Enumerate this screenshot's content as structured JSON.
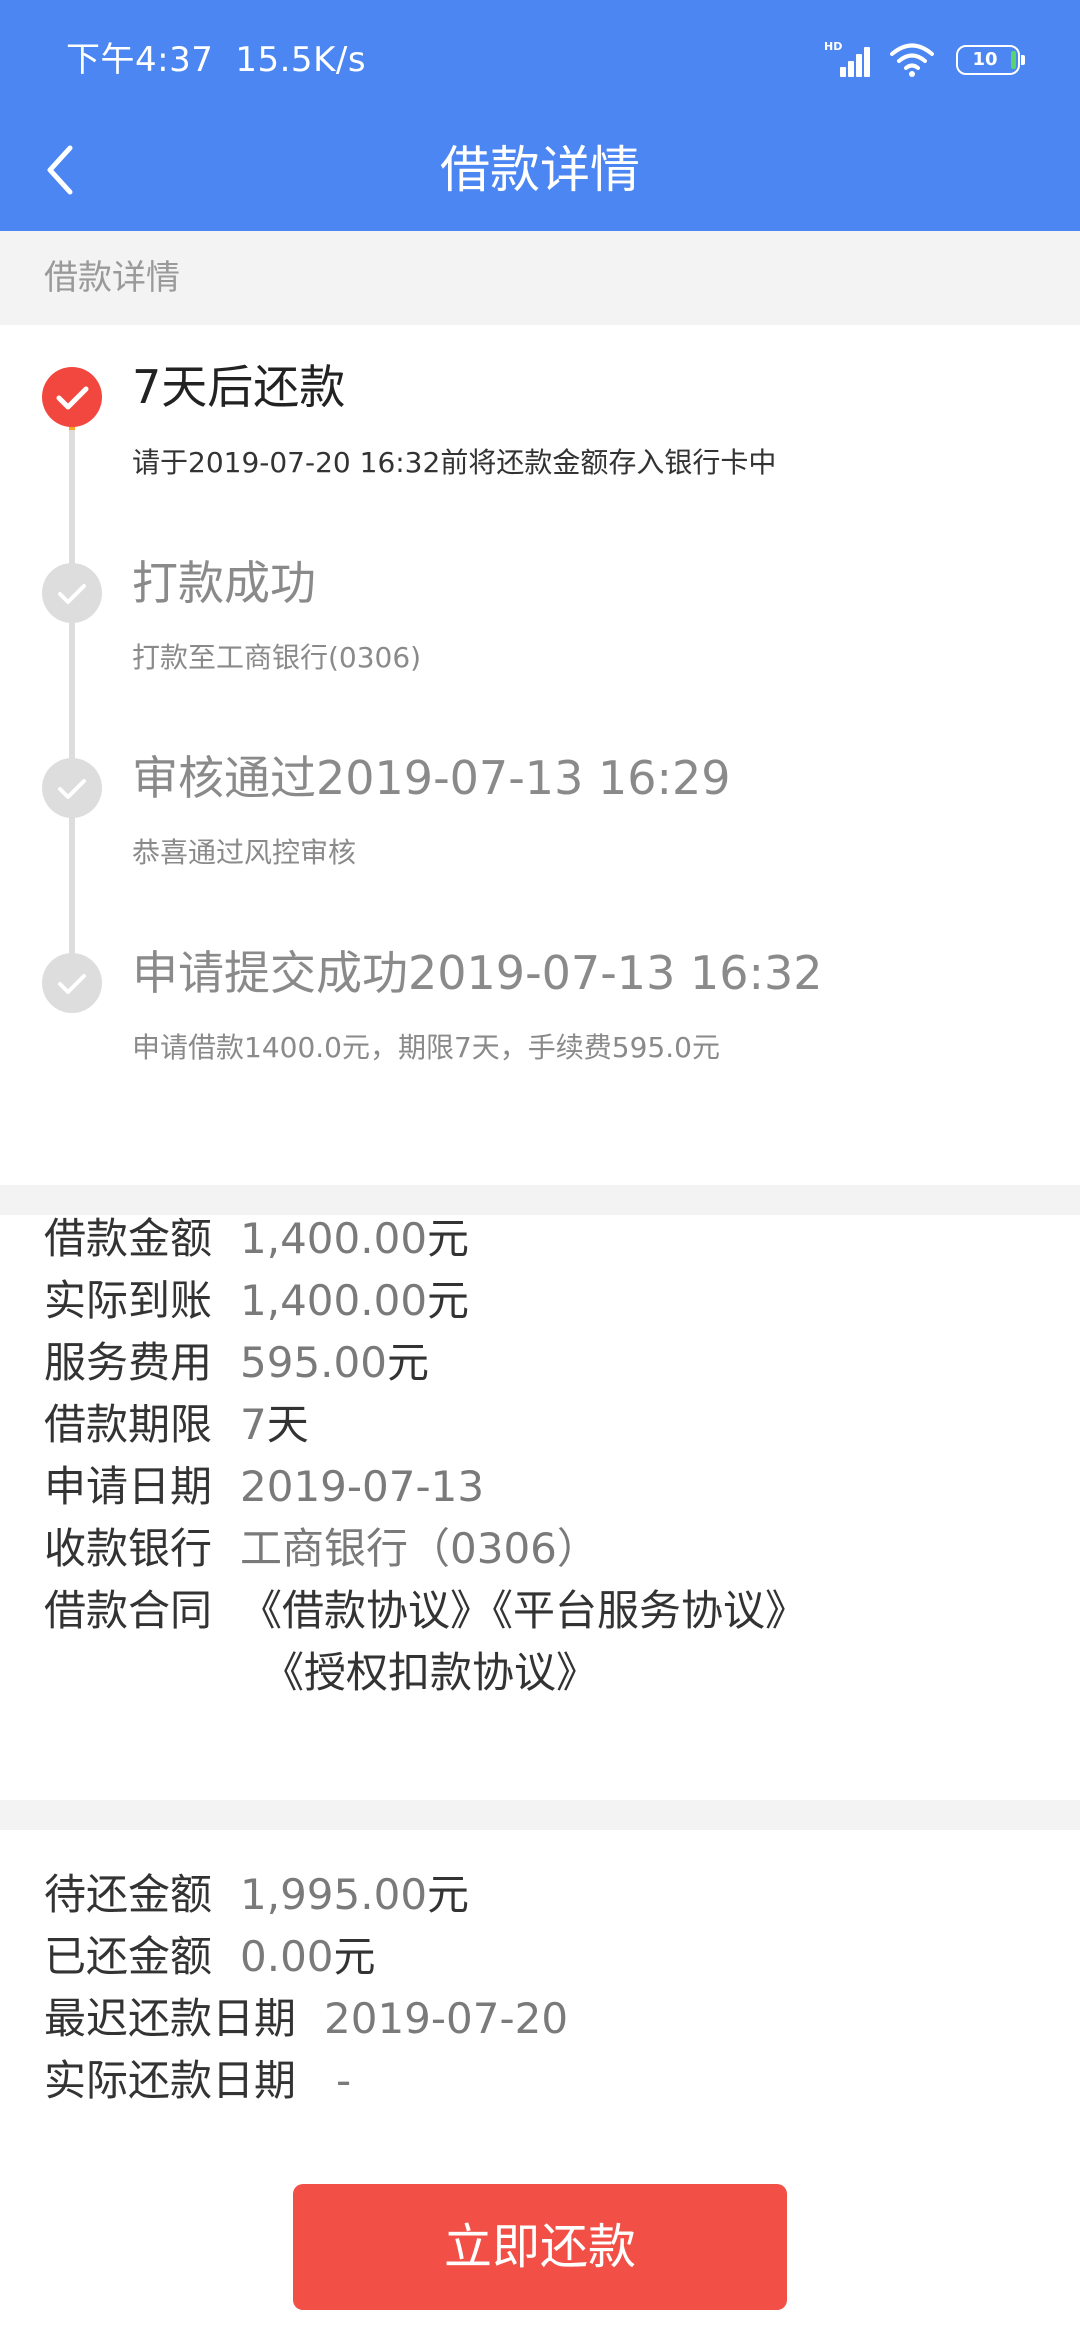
{
  "status_bar": {
    "time": "下午4:37",
    "speed": "15.5K/s",
    "signal_label": "HD",
    "battery_level": "10",
    "icons": [
      "signal-icon",
      "wifi-icon",
      "battery-icon"
    ]
  },
  "nav": {
    "title": "借款详情",
    "back_icon": "chevron-left-icon"
  },
  "section_title": "借款详情",
  "timeline": [
    {
      "title": "7天后还款",
      "desc": "请于2019-07-20 16:32前将还款金额存入银行卡中",
      "active": true
    },
    {
      "title": "打款成功",
      "desc": "打款至工商银行(0306)",
      "active": false
    },
    {
      "title": "审核通过2019-07-13 16:29",
      "desc": "恭喜通过风控审核",
      "active": false
    },
    {
      "title": "申请提交成功2019-07-13 16:32",
      "desc": "申请借款1400.0元，期限7天，手续费595.0元",
      "active": false
    }
  ],
  "loan_info": {
    "amount_label": "借款金额",
    "amount_value": "1,400.00",
    "amount_unit": "元",
    "received_label": "实际到账",
    "received_value": "1,400.00",
    "received_unit": "元",
    "fee_label": "服务费用",
    "fee_value": "595.00",
    "fee_unit": "元",
    "term_label": "借款期限",
    "term_value": "7",
    "term_unit": "天",
    "date_label": "申请日期",
    "date_value": "2019-07-13",
    "bank_label": "收款银行",
    "bank_value": "工商银行（0306）",
    "contract_label": "借款合同",
    "contract_line1": "《借款协议》《平台服务协议》",
    "contract_line2": "《授权扣款协议》"
  },
  "repay_info": {
    "pending_label": "待还金额",
    "pending_value": "1,995.00",
    "pending_unit": "元",
    "paid_label": "已还金额",
    "paid_value": "0.00",
    "paid_unit": "元",
    "latest_date_label": "最迟还款日期",
    "latest_date_value": "2019-07-20",
    "actual_date_label": "实际还款日期",
    "actual_date_value": "-"
  },
  "pay_button": "立即还款",
  "colors": {
    "header": "#4b86f2",
    "active_dot": "#f2473f",
    "active_line": "#f5a623",
    "inactive": "#dddddd",
    "button": "#f25046"
  }
}
